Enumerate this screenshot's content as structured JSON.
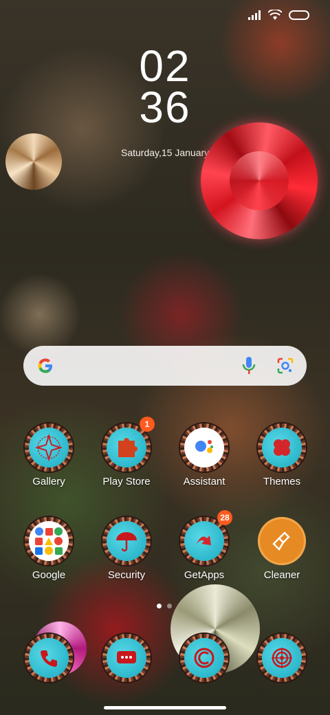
{
  "status": {
    "signal_icon": "signal-bars-icon",
    "wifi_icon": "wifi-icon",
    "battery_icon": "battery-icon"
  },
  "clock": {
    "hour": "02",
    "minute": "36",
    "date": "Saturday,15 January"
  },
  "search": {
    "google_icon": "google-g-icon",
    "mic_icon": "microphone-icon",
    "lens_icon": "lens-icon"
  },
  "apps": [
    {
      "label": "Gallery",
      "icon": "gallery-icon",
      "badge": ""
    },
    {
      "label": "Play Store",
      "icon": "play-store-icon",
      "badge": "1"
    },
    {
      "label": "Assistant",
      "icon": "assistant-icon",
      "badge": ""
    },
    {
      "label": "Themes",
      "icon": "themes-icon",
      "badge": ""
    },
    {
      "label": "Google",
      "icon": "google-folder-icon",
      "badge": ""
    },
    {
      "label": "Security",
      "icon": "security-icon",
      "badge": ""
    },
    {
      "label": "GetApps",
      "icon": "getapps-icon",
      "badge": "28"
    },
    {
      "label": "Cleaner",
      "icon": "cleaner-icon",
      "badge": ""
    }
  ],
  "dock": [
    {
      "icon": "phone-icon"
    },
    {
      "icon": "messages-icon"
    },
    {
      "icon": "browser-icon"
    },
    {
      "icon": "camera-icon"
    }
  ],
  "colors": {
    "badge": "#ff5a1f",
    "cleaner": "#e68a24",
    "bead_inner": "#2db8cc"
  }
}
